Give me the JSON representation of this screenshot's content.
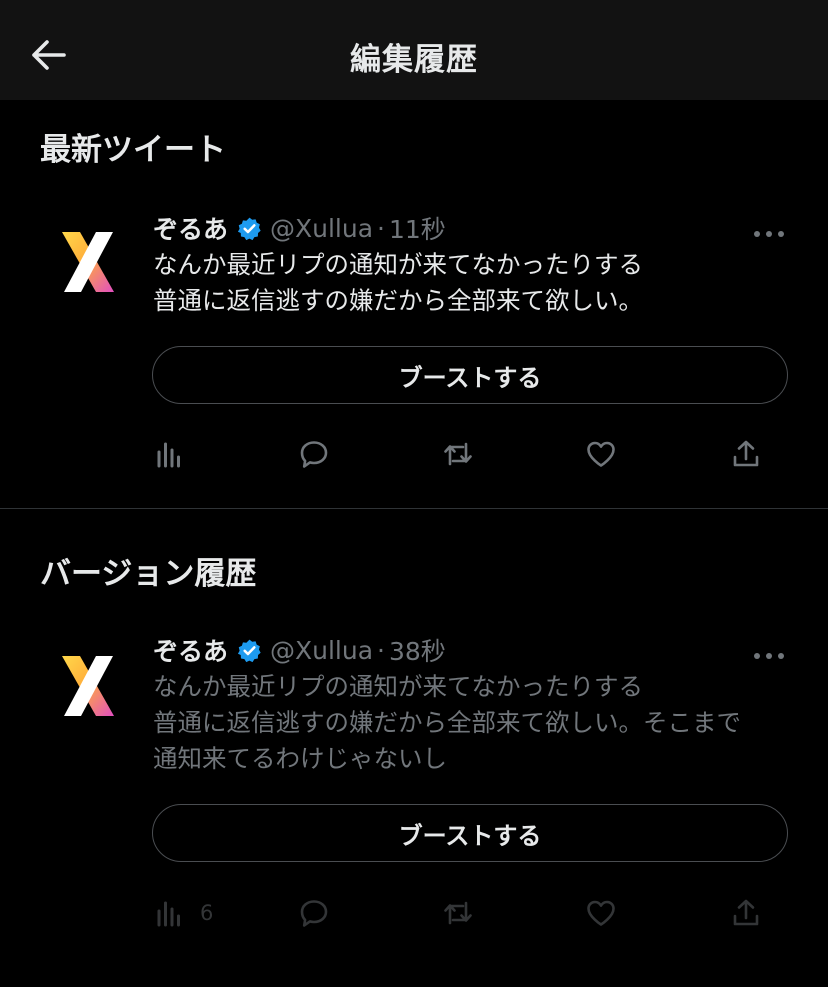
{
  "header": {
    "title": "編集履歴",
    "back_icon": "arrow-left-icon"
  },
  "sections": {
    "latest": {
      "title": "最新ツイート"
    },
    "history": {
      "title": "バージョン履歴"
    }
  },
  "tweets": [
    {
      "name": "ぞるあ",
      "handle": "@Xullua",
      "separator": "·",
      "time": "11秒",
      "lines": [
        "なんか最近リプの通知が来てなかったりする",
        "普通に返信逃すの嫌だから全部来て欲しい。"
      ],
      "dimmed": false,
      "boost_label": "ブーストする",
      "views_count": ""
    },
    {
      "name": "ぞるあ",
      "handle": "@Xullua",
      "separator": "·",
      "time": "38秒",
      "lines": [
        "なんか最近リプの通知が来てなかったりする",
        "普通に返信逃すの嫌だから全部来て欲しい。そこまで",
        "通知来てるわけじゃないし"
      ],
      "dimmed": true,
      "boost_label": "ブーストする",
      "views_count": "6"
    }
  ],
  "colors": {
    "background": "#000000",
    "header": "#121212",
    "verified": "#1d9bf0",
    "muted": "#71767b",
    "text": "#e7e9ea"
  }
}
